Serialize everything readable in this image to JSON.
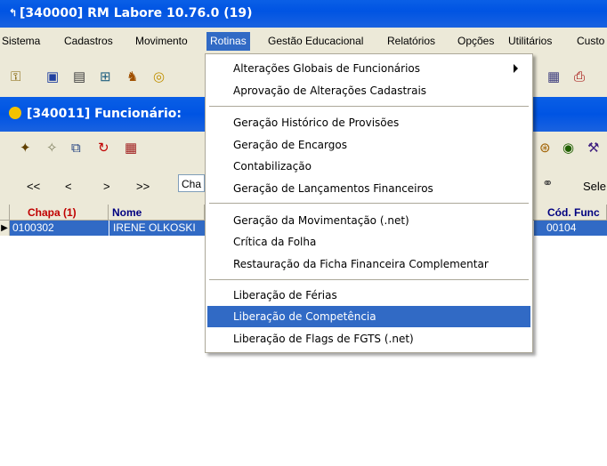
{
  "window": {
    "title": "[340000]  RM Labore 10.76.0 (19)"
  },
  "menubar": {
    "items": [
      "Sistema",
      "Cadastros",
      "Movimento",
      "Rotinas",
      "Gestão Educacional",
      "Relatórios",
      "Opções",
      "Utilitários",
      "Custo"
    ],
    "active": "Rotinas"
  },
  "child_window": {
    "title": "[340011]  Funcionário:"
  },
  "navigation": {
    "first": "<<",
    "prev": "<",
    "next": ">",
    "last": ">>",
    "combo_value": "Cha",
    "select_label": "Sele"
  },
  "grid": {
    "columns": [
      "Chapa (1)",
      "Nome",
      "Cód. Func"
    ],
    "rows": [
      {
        "chapa": "0100302",
        "nome": "IRENE OLKOSKI",
        "cod_func": "00104"
      }
    ]
  },
  "rotinas_menu": {
    "items": [
      "Alterações Globais de Funcionários",
      "Aprovação de Alterações Cadastrais",
      "Geração Histórico de Provisões",
      "Geração de Encargos",
      "Contabilização",
      "Geração de Lançamentos Financeiros",
      "Geração da Movimentação (.net)",
      "Crítica da Folha",
      "Restauração da Ficha Financeira Complementar",
      "Liberação de Férias",
      "Liberação de Competência",
      "Liberação de Flags de FGTS (.net)"
    ],
    "highlighted": "Liberação de Competência"
  },
  "colors": {
    "titlebar": "#0054e3",
    "highlight": "#316ac5",
    "chapa_header": "#c00000",
    "face": "#ece9d8"
  },
  "icons": [
    "app-icon",
    "toolbar-icons",
    "submenu-arrow-icon",
    "row-indicator-icon"
  ]
}
